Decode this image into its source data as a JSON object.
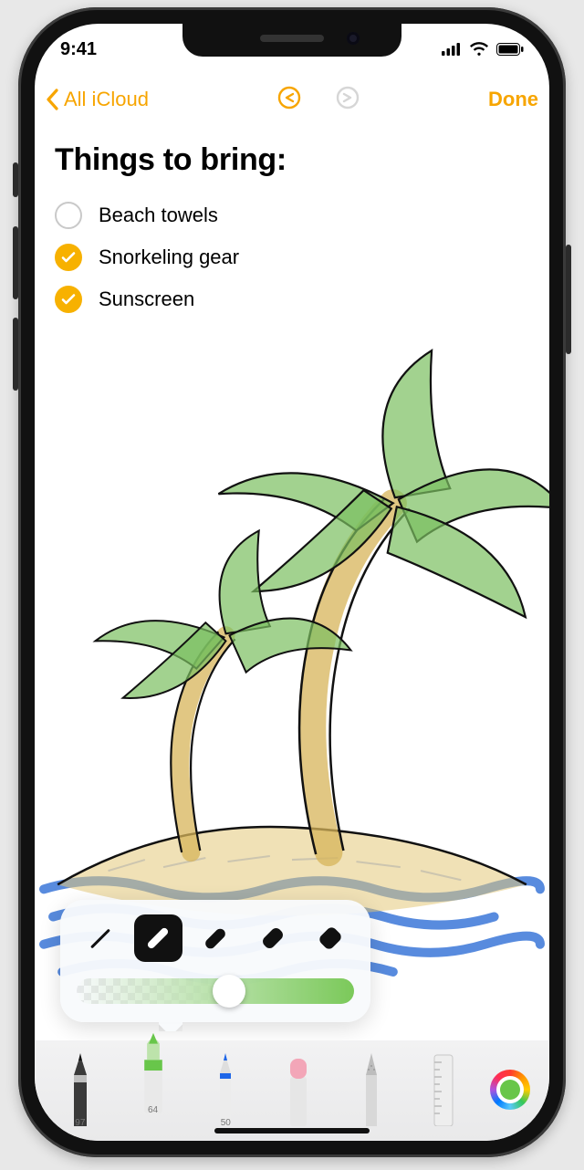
{
  "status": {
    "time": "9:41"
  },
  "nav": {
    "back_label": "All iCloud",
    "done_label": "Done"
  },
  "note": {
    "title": "Things to bring:",
    "items": [
      {
        "text": "Beach towels",
        "checked": false
      },
      {
        "text": "Snorkeling gear",
        "checked": true
      },
      {
        "text": "Sunscreen",
        "checked": true
      }
    ]
  },
  "tools": {
    "selected_index": 1,
    "items": [
      {
        "name": "pen",
        "size_label": "97"
      },
      {
        "name": "marker",
        "size_label": "64"
      },
      {
        "name": "pencil",
        "size_label": "50"
      },
      {
        "name": "eraser",
        "size_label": ""
      },
      {
        "name": "lasso",
        "size_label": ""
      },
      {
        "name": "ruler",
        "size_label": ""
      }
    ],
    "color": "#68c64a"
  },
  "popover": {
    "stroke_selected_index": 1,
    "stroke_count": 5,
    "opacity_percent": 55
  }
}
